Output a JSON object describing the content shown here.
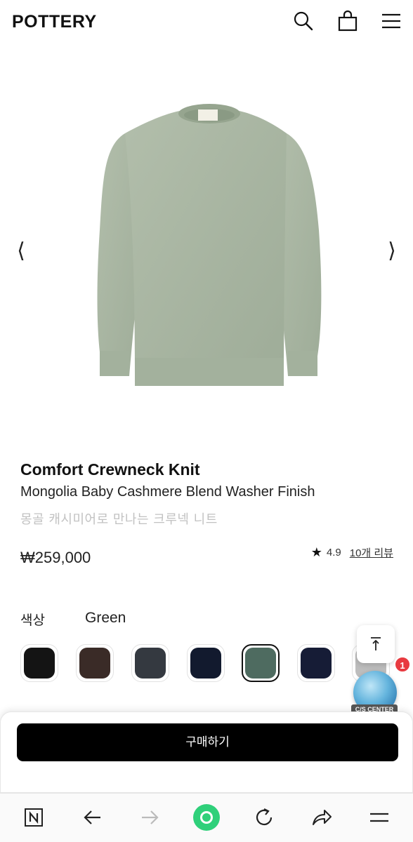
{
  "header": {
    "logo": "POTTERY",
    "icons": [
      "search-icon",
      "shopping-bag-icon",
      "menu-icon"
    ]
  },
  "gallery": {
    "prev_icon": "⟨",
    "next_icon": "⟩",
    "product_color": "#a8b5a0"
  },
  "product": {
    "title": "Comfort Crewneck Knit",
    "subtitle": "Mongolia Baby Cashmere Blend Washer Finish",
    "korean_name": "몽골 캐시미어로 만나는 크루넥 니트",
    "price": "₩259,000",
    "rating": "4.9",
    "reviews": "10개 리뷰"
  },
  "color": {
    "label": "색상",
    "selected": "Green",
    "swatches": [
      "#141414",
      "#3a2b27",
      "#343940",
      "#121a2e",
      "#4e6b60",
      "#161c36",
      "#bdbdbd"
    ],
    "selected_index": 4
  },
  "floating": {
    "cs_label": "C/S CENTER",
    "badge_count": "1"
  },
  "sheet": {
    "buy_label": "구매하기"
  },
  "browser": {
    "icons": [
      "naver-icon",
      "back-icon",
      "forward-icon",
      "home-green-icon",
      "refresh-icon",
      "share-icon",
      "menu-icon"
    ]
  }
}
